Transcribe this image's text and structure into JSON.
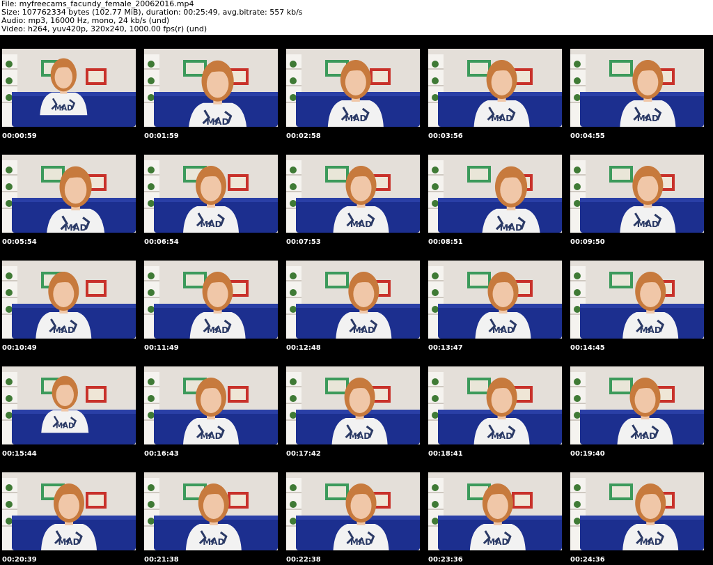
{
  "header": {
    "file_line": "File: myfreecams_facundy_female_20062016.mp4",
    "size_line": "Size: 107762334 bytes (102.77 MiB), duration: 00:25:49, avg.bitrate: 557 kb/s",
    "audio_line": "Audio: mp3, 16000 Hz, mono, 24 kb/s (und)",
    "video_line": "Video: h264, yuv420p, 320x240, 1000.00 fps(r) (und)"
  },
  "shirt_text": "MAD",
  "colors": {
    "wall": "#e4dfd9",
    "couch": "#1c2f8f",
    "hair": "#c77a3d",
    "skin": "#f0c7a8",
    "shirt": "#f2f2f2",
    "frame_green": "#3c9a5b",
    "frame_red": "#c8312a"
  },
  "thumbnails": [
    {
      "time": "00:00:59"
    },
    {
      "time": "00:01:59"
    },
    {
      "time": "00:02:58"
    },
    {
      "time": "00:03:56"
    },
    {
      "time": "00:04:55"
    },
    {
      "time": "00:05:54"
    },
    {
      "time": "00:06:54"
    },
    {
      "time": "00:07:53"
    },
    {
      "time": "00:08:51"
    },
    {
      "time": "00:09:50"
    },
    {
      "time": "00:10:49"
    },
    {
      "time": "00:11:49"
    },
    {
      "time": "00:12:48"
    },
    {
      "time": "00:13:47"
    },
    {
      "time": "00:14:45"
    },
    {
      "time": "00:15:44"
    },
    {
      "time": "00:16:43"
    },
    {
      "time": "00:17:42"
    },
    {
      "time": "00:18:41"
    },
    {
      "time": "00:19:40"
    },
    {
      "time": "00:20:39"
    },
    {
      "time": "00:21:38"
    },
    {
      "time": "00:22:38"
    },
    {
      "time": "00:23:36"
    },
    {
      "time": "00:24:36"
    }
  ]
}
